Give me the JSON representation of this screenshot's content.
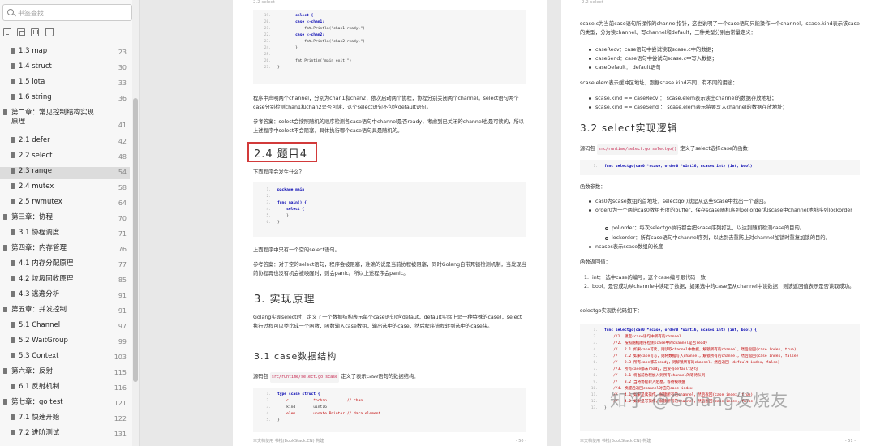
{
  "sidebar": {
    "search_placeholder": "书签查找",
    "tools": [
      "expand-all-icon",
      "collapse-all-icon",
      "bookmark-add-icon",
      "bookmark-icon"
    ],
    "items": [
      {
        "label": "1.3 map",
        "page": "23",
        "level": 2
      },
      {
        "label": "1.4 struct",
        "page": "30",
        "level": 2
      },
      {
        "label": "1.5 iota",
        "page": "33",
        "level": 2
      },
      {
        "label": "1.6 string",
        "page": "36",
        "level": 2
      },
      {
        "label": "第二章：常见控制结构实现原理",
        "page": "41",
        "level": 1
      },
      {
        "label": "2.1 defer",
        "page": "42",
        "level": 2
      },
      {
        "label": "2.2 select",
        "page": "48",
        "level": 2
      },
      {
        "label": "2.3 range",
        "page": "54",
        "level": 2
      },
      {
        "label": "2.4 mutex",
        "page": "58",
        "level": 2
      },
      {
        "label": "2.5 rwmutex",
        "page": "64",
        "level": 2
      },
      {
        "label": "第三章：协程",
        "page": "70",
        "level": 1
      },
      {
        "label": "3.1 协程调度",
        "page": "71",
        "level": 2
      },
      {
        "label": "第四章：内存管理",
        "page": "76",
        "level": 1
      },
      {
        "label": "4.1 内存分配原理",
        "page": "77",
        "level": 2
      },
      {
        "label": "4.2 垃圾回收原理",
        "page": "85",
        "level": 2
      },
      {
        "label": "4.3 逃逸分析",
        "page": "91",
        "level": 2
      },
      {
        "label": "第五章：并发控制",
        "page": "91",
        "level": 1
      },
      {
        "label": "5.1 Channel",
        "page": "97",
        "level": 2
      },
      {
        "label": "5.2 WaitGroup",
        "page": "99",
        "level": 2
      },
      {
        "label": "5.3 Context",
        "page": "103",
        "level": 2
      },
      {
        "label": "第六章：反射",
        "page": "115",
        "level": 1
      },
      {
        "label": "6.1 反射机制",
        "page": "116",
        "level": 2
      },
      {
        "label": "第七章：go test",
        "page": "121",
        "level": 1
      },
      {
        "label": "7.1 快速开始",
        "page": "122",
        "level": 2
      },
      {
        "label": "7.2 进阶测试",
        "page": "131",
        "level": 2
      }
    ]
  },
  "page1": {
    "header": "2.2 select",
    "code1": [
      {
        "n": "19.",
        "t": "        select {"
      },
      {
        "n": "20.",
        "t": "        case <-chan1:"
      },
      {
        "n": "21.",
        "t": "            fmt.Println(\"chan1 ready.\")"
      },
      {
        "n": "22.",
        "t": "        case <-chan2:"
      },
      {
        "n": "23.",
        "t": "            fmt.Println(\"chan2 ready.\")"
      },
      {
        "n": "24.",
        "t": "        }"
      },
      {
        "n": "25.",
        "t": ""
      },
      {
        "n": "26.",
        "t": "        fmt.Println(\"main exit.\")"
      },
      {
        "n": "27.",
        "t": "}"
      }
    ],
    "p1": "程序中声明两个channel，分别为chan1和chan2，依次启动两个协程，协程分别关闭两个channel。select语句两个case分别检测chan1和chan2是否可读，这个select语句不包含default语句。",
    "p2": "参考答案：select会按照随机的顺序检测各case语句中channel是否ready，考虑到已关闭的channel也是可读的，所以上述程序中select不会阻塞，具体执行哪个case语句具是随机的。",
    "heading_24": "2.4 题目4",
    "p3": "下面程序会发生什么？",
    "code2": [
      {
        "n": "1.",
        "t": "package main"
      },
      {
        "n": "2.",
        "t": ""
      },
      {
        "n": "3.",
        "t": "func main() {"
      },
      {
        "n": "4.",
        "t": "    select {"
      },
      {
        "n": "5.",
        "t": "    }"
      },
      {
        "n": "6.",
        "t": "}"
      }
    ],
    "p4": "上面程序中只有一个空的select语句。",
    "p5": "参考答案：对于空的select语句，程序会被阻塞，准确的说是当前协程被阻塞，同时Golang自带死锁检测机制，当发现当前协程再也没有机会被唤醒时，则会panic。所以上述程序会panic。",
    "heading_3": "3. 实现原理",
    "p6": "Golang实现select时，定义了一个数据结构表示每个case语句(含defaut，default实际上是一种特殊的case)，select执行过程可以类比成一个函数，函数输入case数组，输出选中的case，然后程序流程转到选中的case块。",
    "heading_31": "3.1 case数据结构",
    "p7_pre": "源码包",
    "p7_tag": "src/runtime/select.go:scase",
    "p7_post": "定义了表示case语句的数据结构：",
    "code3": [
      {
        "n": "1.",
        "t": "type scase struct {"
      },
      {
        "n": "2.",
        "t": "    c           *hchan         // chan"
      },
      {
        "n": "3.",
        "t": "    kind        uint16"
      },
      {
        "n": "4.",
        "t": "    elem        unsafe.Pointer // data element"
      },
      {
        "n": "5.",
        "t": "}"
      }
    ],
    "footer_left": "本文档使用 书栈(BookStack.CN) 构建",
    "footer_right": "- 50 -"
  },
  "page2": {
    "header": "2.2 select",
    "p1": "scase.c为当前case语句所操作的channel指针，这也说明了一个case语句只能操作一个channel。scase.kind表示该case的类型，分为读channel、写channel和default，三种类型分别由常量定义：",
    "b1": [
      "caseRecv：case语句中尝试读取scase.c中的数据；",
      "caseSend：case语句中尝试向scase.c中写入数据；",
      "caseDefault： default语句"
    ],
    "p2": "scase.elem表示缓冲区地址，跟据scase.kind不同，有不同的用途：",
    "b2": [
      "scase.kind == caseRecv ： scase.elem表示读出channel的数据存放地址；",
      "scase.kind == caseSend ： scase.elem表示将要写入channel的数据存放地址；"
    ],
    "heading_32": "3.2 select实现逻辑",
    "p3_pre": "源码包",
    "p3_tag": "src/runtime/select.go:selectgo()",
    "p3_post": "定义了select选择case的函数：",
    "code1": [
      {
        "n": "1.",
        "t": "func selectgo(cas0 *scase, order0 *uint16, ncases int) (int, bool)"
      }
    ],
    "p4": "函数参数：",
    "b3": [
      "cas0为scase数组的首地址，selectgo()就是从这些scase中找出一个返回。",
      "order0为一个两倍cas0数组长度的buffer，保存scase随机序列pollorder和scase中channel地址序列lockorder"
    ],
    "b3sub": [
      "pollorder：每次selectgo执行都会把scase序列打乱，以达到随机检测case的目的。",
      "lockorder：所有case语句中channel序列，以达到去重防止对channel加锁时重复加锁的目的。"
    ],
    "b4": "ncases表示scase数组的长度",
    "p5": "函数返回值：",
    "n1": [
      "int： 选中case的编号，这个case编号跟代码一致",
      "bool：是否成功从channle中读取了数据，如果选中的case是从channel中读数据，则该返回值表示是否读取成功。"
    ],
    "p6": "selectgo实现伪代码如下：",
    "code2": [
      {
        "n": "1.",
        "t": "func selectgo(cas0 *scase, order0 *uint16, ncases int) (int, bool) {"
      },
      {
        "n": "2.",
        "t": "    //1. 锁定scase语句中所有的channel"
      },
      {
        "n": "3.",
        "t": "    //2. 按照随机顺序检测scase中的channel是否ready"
      },
      {
        "n": "4.",
        "t": "    //   2.1 如果case可读，则读取channel中数据，解锁所有的channel，然后返回(case index, true)"
      },
      {
        "n": "5.",
        "t": "    //   2.2 如果case可写，则将数据写入channel，解锁所有的channel，然后返回(case index, false)"
      },
      {
        "n": "6.",
        "t": "    //   2.3 所有case都未ready，则解锁所有的channel，然后返回（default index, false)"
      },
      {
        "n": "7.",
        "t": "    //3. 所有case都未ready，且没有default语句"
      },
      {
        "n": "8.",
        "t": "    //   3.1 将当前协程加入到所有channel的等待队列"
      },
      {
        "n": "9.",
        "t": "    //   3.2 当将协程转入阻塞，等待被唤醒"
      },
      {
        "n": "10.",
        "t": "    //4. 唤醒后返回channel对应的case index"
      },
      {
        "n": "11.",
        "t": "    //   4.1 如果是读操作，解锁所有的channel，然后返回(case index, true)"
      },
      {
        "n": "12.",
        "t": "    //   4.2 如果是写操作，解锁所有的channel，然后返回(case index, false)"
      },
      {
        "n": "13.",
        "t": "}"
      }
    ],
    "watermark": "知乎 @Golang发烧友",
    "footer_left": "本文档使用 书栈(BookStack.CN) 构建",
    "footer_right": "- 51 -"
  }
}
